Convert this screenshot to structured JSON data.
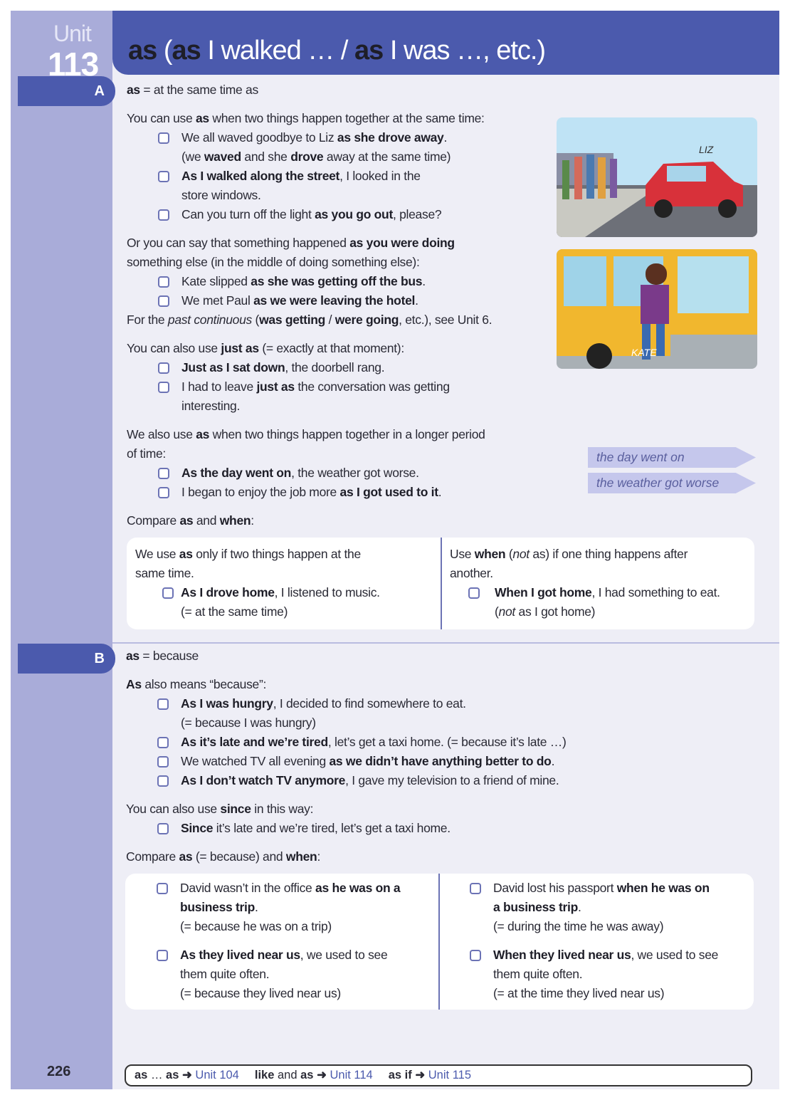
{
  "unit": {
    "word": "Unit",
    "number": "113"
  },
  "title": [
    {
      "t": "as",
      "s": "b"
    },
    {
      "t": " (",
      "s": ""
    },
    {
      "t": "as",
      "s": "b"
    },
    {
      "t": " I walked … / ",
      "s": ""
    },
    {
      "t": "as",
      "s": "b"
    },
    {
      "t": " I was …, etc.)",
      "s": ""
    }
  ],
  "sectionA": {
    "label": "A",
    "heading": [
      {
        "t": "as",
        "s": "b"
      },
      {
        "t": " = at the same time as",
        "s": ""
      }
    ],
    "p1": [
      {
        "t": "You can use ",
        "s": ""
      },
      {
        "t": "as",
        "s": "b"
      },
      {
        "t": " when two things happen together at the same time:",
        "s": ""
      }
    ],
    "ex1": [
      [
        {
          "t": "We all waved goodbye to Liz ",
          "s": ""
        },
        {
          "t": "as she drove away",
          "s": "b"
        },
        {
          "t": ".",
          "s": ""
        }
      ],
      [
        {
          "t": "(we ",
          "s": ""
        },
        {
          "t": "waved",
          "s": "b"
        },
        {
          "t": " and she ",
          "s": ""
        },
        {
          "t": "drove",
          "s": "b"
        },
        {
          "t": " away at the same time)",
          "s": ""
        }
      ]
    ],
    "ex2": [
      [
        {
          "t": "As I walked along the street",
          "s": "b"
        },
        {
          "t": ", I looked in the",
          "s": ""
        }
      ],
      [
        {
          "t": "store windows.",
          "s": ""
        }
      ]
    ],
    "ex3": [
      [
        {
          "t": "Can you turn off the light ",
          "s": ""
        },
        {
          "t": "as you go out",
          "s": "b"
        },
        {
          "t": ", please?",
          "s": ""
        }
      ]
    ],
    "p2": [
      [
        {
          "t": "Or you can say that something happened ",
          "s": ""
        },
        {
          "t": "as you were doing",
          "s": "b"
        }
      ],
      [
        {
          "t": "something else (in the middle of doing something else):",
          "s": ""
        }
      ]
    ],
    "ex4": [
      [
        {
          "t": "Kate slipped ",
          "s": ""
        },
        {
          "t": "as she was getting off the bus",
          "s": "b"
        },
        {
          "t": ".",
          "s": ""
        }
      ]
    ],
    "ex5": [
      [
        {
          "t": "We met Paul ",
          "s": ""
        },
        {
          "t": "as we were leaving the hotel",
          "s": "b"
        },
        {
          "t": ".",
          "s": ""
        }
      ]
    ],
    "p3": [
      {
        "t": "For the ",
        "s": ""
      },
      {
        "t": "past continuous",
        "s": "i"
      },
      {
        "t": " (",
        "s": ""
      },
      {
        "t": "was getting",
        "s": "b"
      },
      {
        "t": " / ",
        "s": ""
      },
      {
        "t": "were going",
        "s": "b"
      },
      {
        "t": ", etc.), see Unit 6.",
        "s": ""
      }
    ],
    "p4": [
      {
        "t": "You can also use ",
        "s": ""
      },
      {
        "t": "just as",
        "s": "b"
      },
      {
        "t": " (= exactly at that moment):",
        "s": ""
      }
    ],
    "ex6": [
      [
        {
          "t": "Just as I sat down",
          "s": "b"
        },
        {
          "t": ", the doorbell rang.",
          "s": ""
        }
      ]
    ],
    "ex7": [
      [
        {
          "t": "I had to leave ",
          "s": ""
        },
        {
          "t": "just as",
          "s": "b"
        },
        {
          "t": " the conversation was getting",
          "s": ""
        }
      ],
      [
        {
          "t": "interesting.",
          "s": ""
        }
      ]
    ],
    "p5": [
      [
        {
          "t": "We also use ",
          "s": ""
        },
        {
          "t": "as",
          "s": "b"
        },
        {
          "t": " when two things happen together in a longer period",
          "s": ""
        }
      ],
      [
        {
          "t": "of time:",
          "s": ""
        }
      ]
    ],
    "ex8": [
      [
        {
          "t": "As the day went on",
          "s": "b"
        },
        {
          "t": ", the weather got worse.",
          "s": ""
        }
      ]
    ],
    "ex9": [
      [
        {
          "t": "I began to enjoy the job more ",
          "s": ""
        },
        {
          "t": "as I got used to it",
          "s": "b"
        },
        {
          "t": ".",
          "s": ""
        }
      ]
    ],
    "arrows": [
      "the day went on",
      "the weather got worse"
    ],
    "picture_labels": [
      "LIZ",
      "KATE"
    ],
    "p6": [
      {
        "t": "Compare ",
        "s": ""
      },
      {
        "t": "as",
        "s": "b"
      },
      {
        "t": " and ",
        "s": ""
      },
      {
        "t": "when",
        "s": "b"
      },
      {
        "t": ":",
        "s": ""
      }
    ],
    "cmp_left": {
      "intro": [
        [
          {
            "t": "We use ",
            "s": ""
          },
          {
            "t": "as",
            "s": "b"
          },
          {
            "t": " only if two things happen at the",
            "s": ""
          }
        ],
        [
          {
            "t": "same time.",
            "s": ""
          }
        ]
      ],
      "ex": [
        [
          {
            "t": "As I drove home",
            "s": "b"
          },
          {
            "t": ", I listened to music.",
            "s": ""
          }
        ],
        [
          {
            "t": "(= at the same time)",
            "s": ""
          }
        ]
      ]
    },
    "cmp_right": {
      "intro": [
        [
          {
            "t": "Use ",
            "s": ""
          },
          {
            "t": "when",
            "s": "b"
          },
          {
            "t": " (",
            "s": ""
          },
          {
            "t": "not",
            "s": "i"
          },
          {
            "t": " as) if one thing happens after",
            "s": ""
          }
        ],
        [
          {
            "t": "another.",
            "s": ""
          }
        ]
      ],
      "ex": [
        [
          {
            "t": "When I got home",
            "s": "b"
          },
          {
            "t": ", I had something to eat.",
            "s": ""
          }
        ],
        [
          {
            "t": "(",
            "s": ""
          },
          {
            "t": "not",
            "s": "i"
          },
          {
            "t": " as I got home)",
            "s": ""
          }
        ]
      ]
    }
  },
  "sectionB": {
    "label": "B",
    "heading": [
      {
        "t": "as",
        "s": "b"
      },
      {
        "t": " = because",
        "s": ""
      }
    ],
    "p1": [
      {
        "t": "As",
        "s": "b"
      },
      {
        "t": " also means “because”:",
        "s": ""
      }
    ],
    "ex1": [
      [
        {
          "t": "As I was hungry",
          "s": "b"
        },
        {
          "t": ", I decided to find somewhere to eat.",
          "s": ""
        }
      ],
      [
        {
          "t": "(= because I was hungry)",
          "s": ""
        }
      ]
    ],
    "ex2": [
      [
        {
          "t": "As it’s late and we’re tired",
          "s": "b"
        },
        {
          "t": ", let’s get a taxi home.  (= because it’s late …)",
          "s": ""
        }
      ]
    ],
    "ex3": [
      [
        {
          "t": "We watched TV all evening ",
          "s": ""
        },
        {
          "t": "as we didn’t have anything better to do",
          "s": "b"
        },
        {
          "t": ".",
          "s": ""
        }
      ]
    ],
    "ex4": [
      [
        {
          "t": "As I don’t watch TV anymore",
          "s": "b"
        },
        {
          "t": ", I gave my television to a friend of mine.",
          "s": ""
        }
      ]
    ],
    "p2": [
      {
        "t": "You can also use ",
        "s": ""
      },
      {
        "t": "since",
        "s": "b"
      },
      {
        "t": " in this way:",
        "s": ""
      }
    ],
    "ex5": [
      [
        {
          "t": "Since",
          "s": "b"
        },
        {
          "t": " it’s late and we’re tired, let’s get a taxi home.",
          "s": ""
        }
      ]
    ],
    "p3": [
      {
        "t": "Compare ",
        "s": ""
      },
      {
        "t": "as",
        "s": "b"
      },
      {
        "t": " (= because) and ",
        "s": ""
      },
      {
        "t": "when",
        "s": "b"
      },
      {
        "t": ":",
        "s": ""
      }
    ],
    "cmp_left": [
      [
        [
          {
            "t": "David wasn’t in the office ",
            "s": ""
          },
          {
            "t": "as he was on a",
            "s": "b"
          }
        ],
        [
          {
            "t": "business trip",
            "s": "b"
          },
          {
            "t": ".",
            "s": ""
          }
        ],
        [
          {
            "t": "(= because he was on a trip)",
            "s": ""
          }
        ]
      ],
      [
        [
          {
            "t": "As they lived near us",
            "s": "b"
          },
          {
            "t": ", we used to see",
            "s": ""
          }
        ],
        [
          {
            "t": "them quite often.",
            "s": ""
          }
        ],
        [
          {
            "t": "(= because they lived near us)",
            "s": ""
          }
        ]
      ]
    ],
    "cmp_right": [
      [
        [
          {
            "t": "David lost his passport ",
            "s": ""
          },
          {
            "t": "when he was on",
            "s": "b"
          }
        ],
        [
          {
            "t": "a business trip",
            "s": "b"
          },
          {
            "t": ".",
            "s": ""
          }
        ],
        [
          {
            "t": "(= during the time he was away)",
            "s": ""
          }
        ]
      ],
      [
        [
          {
            "t": "When they lived near us",
            "s": "b"
          },
          {
            "t": ", we used to see",
            "s": ""
          }
        ],
        [
          {
            "t": "them quite often.",
            "s": ""
          }
        ],
        [
          {
            "t": "(= at the time they lived near us)",
            "s": ""
          }
        ]
      ]
    ]
  },
  "footer": {
    "page_number": "226",
    "refs": [
      {
        "pre": [
          {
            "t": "as",
            "s": "b"
          },
          {
            "t": " … ",
            "s": ""
          },
          {
            "t": "as",
            "s": "b"
          }
        ],
        "link": "Unit 104"
      },
      {
        "pre": [
          {
            "t": "like",
            "s": "b"
          },
          {
            "t": " and ",
            "s": ""
          },
          {
            "t": "as",
            "s": "b"
          }
        ],
        "link": "Unit 114"
      },
      {
        "pre": [
          {
            "t": "as if",
            "s": "b"
          }
        ],
        "link": "Unit 115"
      }
    ],
    "arrow": "➜"
  },
  "colors": {
    "header": "#4b5aad",
    "sidebar": "#a9acd9",
    "page": "#eeeef6",
    "link": "#4b5aad"
  }
}
